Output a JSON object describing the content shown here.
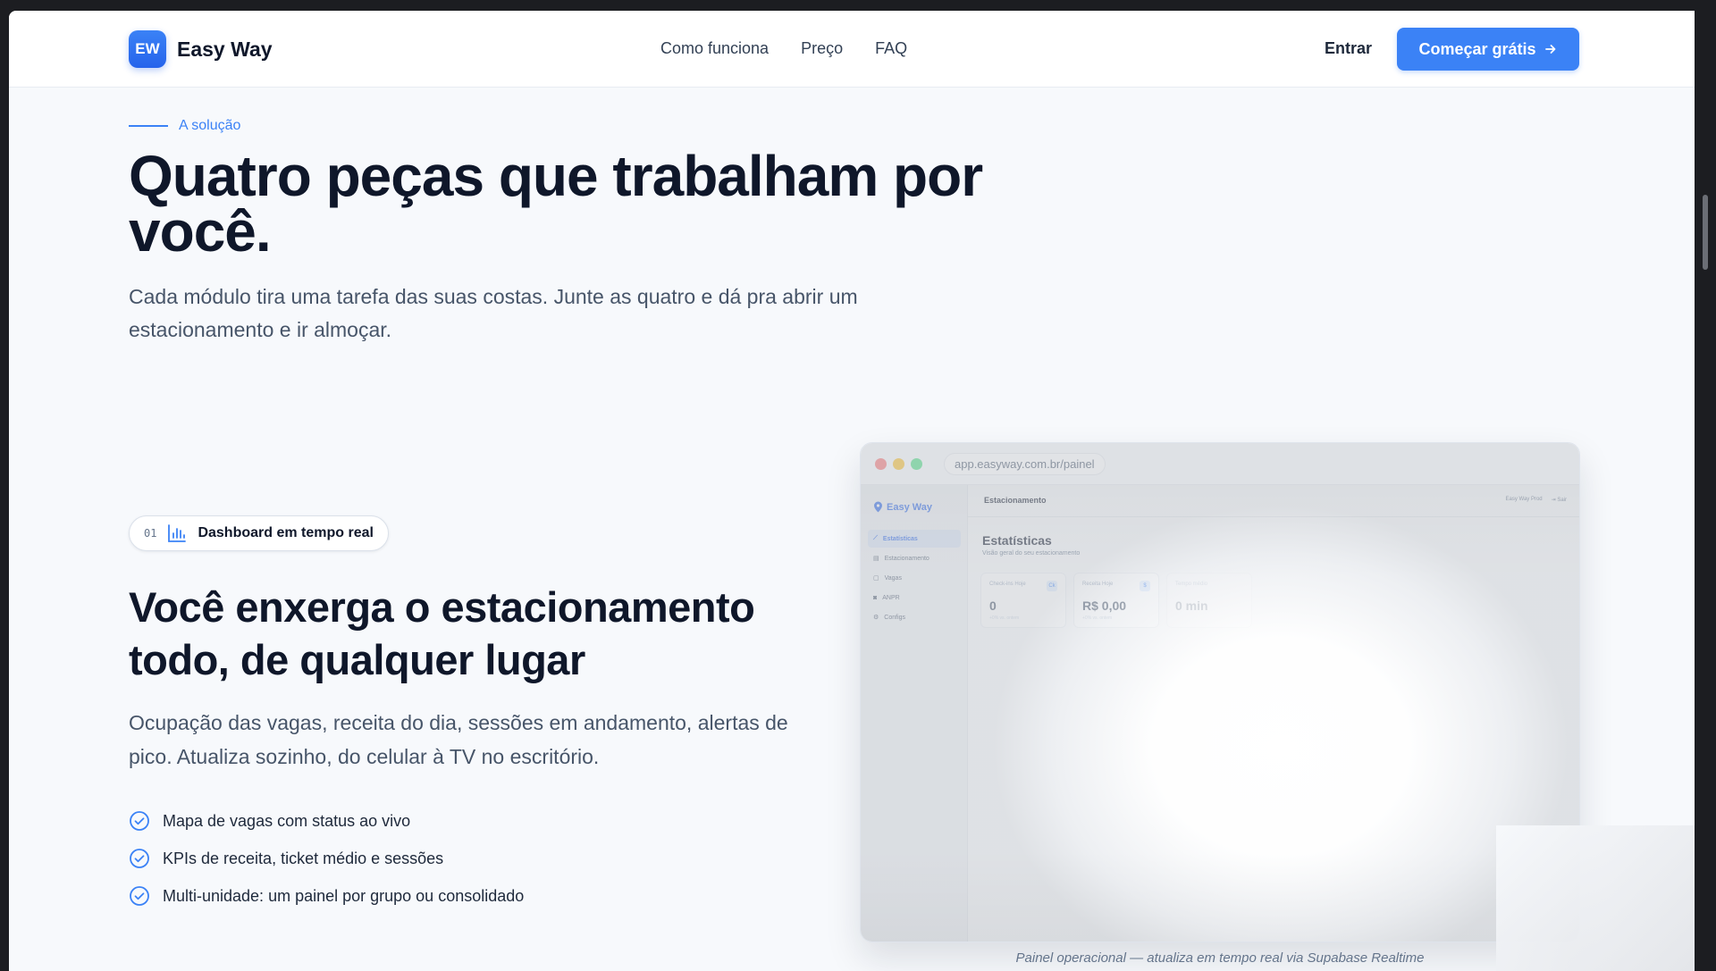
{
  "header": {
    "logo_text": "EW",
    "brand": "Easy Way",
    "nav": [
      "Como funciona",
      "Preço",
      "FAQ"
    ],
    "login": "Entrar",
    "cta": "Começar grátis",
    "cta_icon": "arrow-right-icon"
  },
  "hero": {
    "eyebrow": "A solução",
    "title": "Quatro peças que trabalham por você.",
    "subtitle": "Cada módulo tira uma tarefa das suas costas. Junte as quatro e dá pra abrir um estacionamento e ir almoçar."
  },
  "feature": {
    "pill_number": "01",
    "pill_icon": "bar-chart-icon",
    "pill_label": "Dashboard em tempo real",
    "title": "Você enxerga o estacionamento todo, de qualquer lugar",
    "subtitle": "Ocupação das vagas, receita do dia, sessões em andamento, alertas de pico. Atualiza sozinho, do celular à TV no escritório.",
    "checks": [
      "Mapa de vagas com status ao vivo",
      "KPIs de receita, ticket médio e sessões",
      "Multi-unidade: um painel por grupo ou consolidado"
    ]
  },
  "mockup": {
    "url": "app.easyway.com.br/painel",
    "app_brand": "Easy Way",
    "sidebar": [
      "Estatísticas",
      "Estacionamento",
      "Vagas",
      "ANPR",
      "Configs"
    ],
    "header_title": "Estacionamento",
    "header_right": [
      "Easy Way Prod",
      "Sair"
    ],
    "page_title": "Estatísticas",
    "page_subtitle": "Visão geral do seu estacionamento",
    "kpis": [
      {
        "label": "Check-ins Hoje",
        "value": "0",
        "sub": "+0% vs. ontem",
        "icon": "Ck"
      },
      {
        "label": "Receita Hoje",
        "value": "R$ 0,00",
        "sub": "+0% vs. ontem",
        "icon": "$"
      },
      {
        "label": "Tempo médio",
        "value": "0 min",
        "sub": "",
        "icon": ""
      }
    ],
    "caption": "Painel operacional — atualiza em tempo real via Supabase Realtime"
  },
  "colors": {
    "accent": "#3b82f6",
    "text": "#0f172a",
    "muted": "#475569",
    "background": "#f7f9fc"
  }
}
